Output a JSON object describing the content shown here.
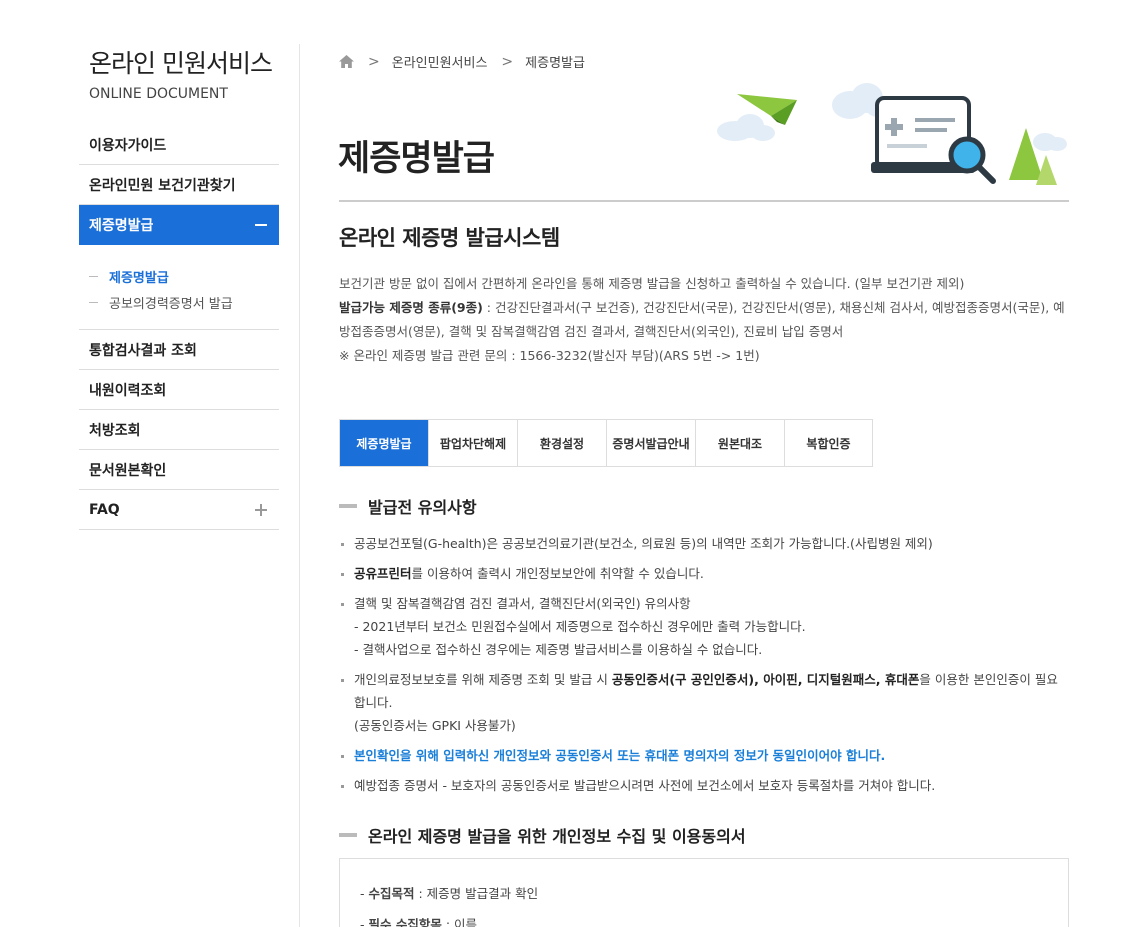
{
  "sidebar": {
    "title": "온라인 민원서비스",
    "subtitle": "ONLINE DOCUMENT",
    "items": [
      {
        "label": "이용자가이드"
      },
      {
        "label": "온라인민원 보건기관찾기"
      },
      {
        "label": "제증명발급"
      },
      {
        "label": "통합검사결과 조회"
      },
      {
        "label": "내원이력조회"
      },
      {
        "label": "처방조회"
      },
      {
        "label": "문서원본확인"
      },
      {
        "label": "FAQ"
      }
    ],
    "sub_items": [
      {
        "label": "제증명발급"
      },
      {
        "label": "공보의경력증명서 발급"
      }
    ]
  },
  "breadcrumb": {
    "items": [
      "온라인민원서비스",
      "제증명발급"
    ],
    "separator": ">"
  },
  "page_title": "제증명발급",
  "section_title": "온라인 제증명 발급시스템",
  "intro": {
    "line1": "보건기관 방문 없이 집에서 간편하게 온라인을 통해 제증명 발급을 신청하고 출력하실 수 있습니다. (일부 보건기관 제외)",
    "types_label": "발급가능 제증명 종류(9종)",
    "types_text": " : 건강진단결과서(구 보건증), 건강진단서(국문), 건강진단서(영문), 채용신체 검사서, 예방접종증명서(국문), 예방접종증명서(영문), 결핵 및 잠복결핵감염 검진 결과서, 결핵진단서(외국인), 진료비 납입 증명서",
    "contact": "※ 온라인 제증명 발급 관련 문의 : 1566-3232(발신자 부담)(ARS 5번 -> 1번)"
  },
  "tabs": [
    {
      "label": "제증명발급"
    },
    {
      "label": "팝업차단해제"
    },
    {
      "label": "환경설정"
    },
    {
      "label": "증명서발급안내"
    },
    {
      "label": "원본대조"
    },
    {
      "label": "복합인증"
    }
  ],
  "notice": {
    "heading": "발급전 유의사항",
    "n1": "공공보건포털(G-health)은 공공보건의료기관(보건소, 의료원 등)의 내역만 조회가 가능합니다.(사립병원 제외)",
    "n2_bold": "공유프린터",
    "n2_rest": "를 이용하여 출력시 개인정보보안에 취약할 수 있습니다.",
    "n3_a": "결핵 및 잠복결핵감염 검진 결과서, 결핵진단서(외국인) 유의사항",
    "n3_b": "- 2021년부터 보건소 민원접수실에서 제증명으로 접수하신 경우에만 출력 가능합니다.",
    "n3_c": "- 결핵사업으로 접수하신 경우에는 제증명 발급서비스를 이용하실 수 없습니다.",
    "n4_a": "개인의료정보보호를 위해 제증명 조회 및 발급 시 ",
    "n4_b1": "공동인증서(구 공인인증서), 아이핀, 디지털원패스, 휴대폰",
    "n4_c": "을 이용한 본인인증이 필요합니다.",
    "n4_d": "(공동인증서는 GPKI 사용불가)",
    "n5": "본인확인을 위해 입력하신 개인정보와 공동인증서 또는 휴대폰 명의자의 정보가 동일인이어야 합니다.",
    "n6": "예방접종 증명서 - 보호자의 공동인증서로 발급받으시려면 사전에 보건소에서 보호자 등록절차를 거쳐야 합니다."
  },
  "consent": {
    "heading": "온라인 제증명 발급을 위한 개인정보 수집 및 이용동의서",
    "purpose_label": "수집목적",
    "purpose_value": " : 제증명 발급결과 확인",
    "items_label": "필수 수집항목",
    "items_value": " : 이름"
  },
  "colors": {
    "accent": "#1a6fd8",
    "notice_blue": "#1a7fd8"
  }
}
